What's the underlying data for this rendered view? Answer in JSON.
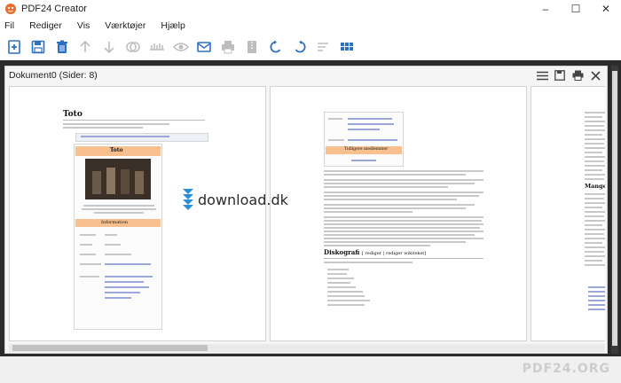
{
  "window": {
    "title": "PDF24 Creator",
    "minimize": "–",
    "maximize": "☐",
    "close": "✕"
  },
  "menu": {
    "items": [
      "Fil",
      "Rediger",
      "Vis",
      "Værktøjer",
      "Hjælp"
    ]
  },
  "toolbar": {
    "icons": [
      "add-file-icon",
      "save-icon",
      "delete-icon",
      "move-up-icon",
      "move-down-icon",
      "merge-icon",
      "split-icon",
      "preview-icon",
      "email-icon",
      "print-icon",
      "compress-icon",
      "rotate-left-icon",
      "rotate-right-icon",
      "sort-icon",
      "grid-view-icon"
    ]
  },
  "document": {
    "title": "Dokument0 (Sider: 8)"
  },
  "pages": {
    "page1": {
      "heading": "Toto",
      "box_title": "Toto",
      "members_bar": "Information",
      "caption": "Toto live: fra venstre: Steve Porcaro, Steve Lukather, Simon Phillips, David Paich og Joseph Williams"
    },
    "page2": {
      "infobox_header": "Tidligere medlemmer",
      "section_title": "Diskografi",
      "section_suffix": "[ rediger | rediger wikitekst]"
    },
    "page3": {
      "section_title": "Mange forske"
    }
  },
  "watermark": {
    "text": "download.dk"
  },
  "branding": {
    "text": "PDF24.ORG"
  },
  "colors": {
    "accent_blue": "#2c70c2",
    "frame_dark": "#2b2b2b",
    "orange_bar": "#f7c08e"
  }
}
